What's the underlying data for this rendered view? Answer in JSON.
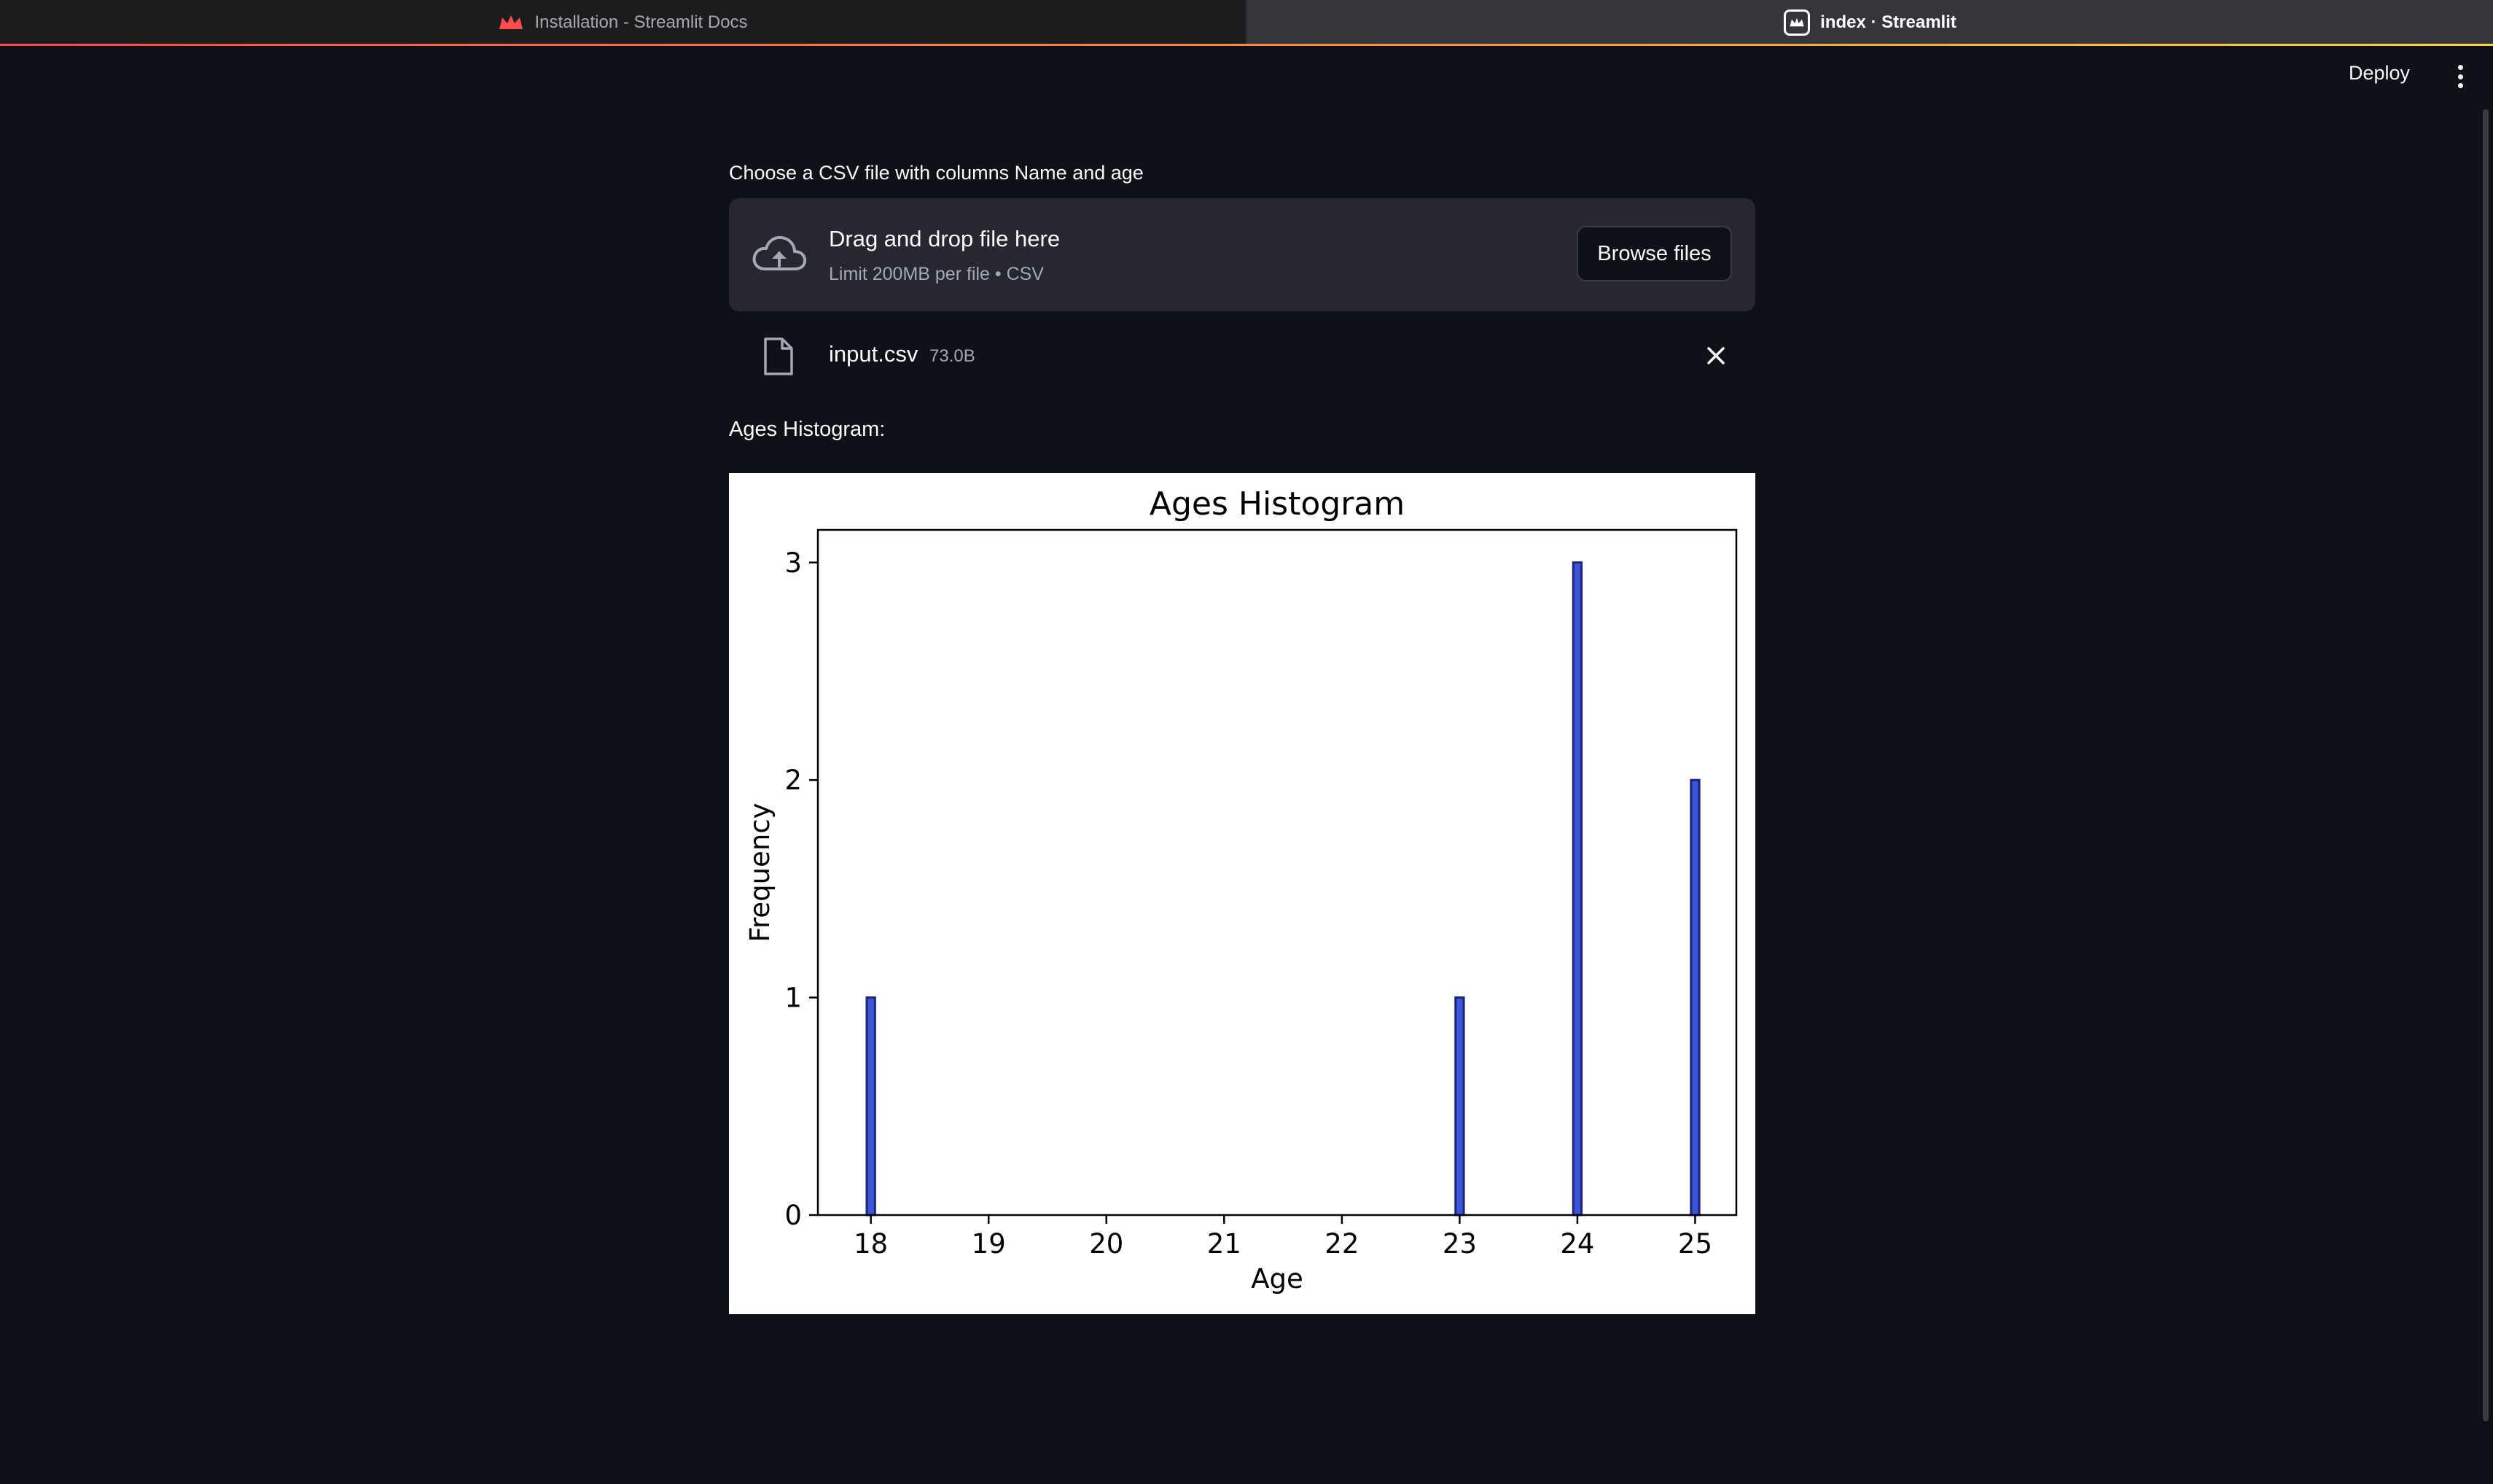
{
  "browser": {
    "tabs": [
      {
        "label": "Installation - Streamlit Docs",
        "icon": "streamlit-crown-icon",
        "active": false
      },
      {
        "label": "index · Streamlit",
        "icon": "streamlit-app-icon",
        "active": true
      }
    ]
  },
  "header": {
    "deploy_label": "Deploy",
    "menu_icon": "vertical-dots-icon"
  },
  "uploader": {
    "label": "Choose a CSV file with columns Name and age",
    "drop_title": "Drag and drop file here",
    "drop_subtitle": "Limit 200MB per file • CSV",
    "browse_label": "Browse files",
    "upload_icon": "cloud-upload-icon"
  },
  "uploaded_file": {
    "name": "input.csv",
    "size": "73.0B",
    "icon": "file-icon",
    "remove_icon": "close-icon"
  },
  "section_label": "Ages Histogram:",
  "colors": {
    "background": "#0e1117",
    "dropzone": "#262730",
    "bar_fill": "#3d56d6",
    "bar_edge": "#1a237e",
    "accent": "#ff4b4b"
  },
  "chart_data": {
    "type": "bar",
    "title": "Ages Histogram",
    "xlabel": "Age",
    "ylabel": "Frequency",
    "xticks": [
      18,
      19,
      20,
      21,
      22,
      23,
      24,
      25
    ],
    "yticks": [
      0,
      1,
      2,
      3
    ],
    "xlim": [
      17.55,
      25.35
    ],
    "ylim": [
      0,
      3.15
    ],
    "bin_width": 0.07,
    "bars": [
      {
        "x": 18,
        "value": 1
      },
      {
        "x": 23,
        "value": 1
      },
      {
        "x": 24,
        "value": 3
      },
      {
        "x": 25,
        "value": 2
      }
    ],
    "grid": false,
    "legend": false
  }
}
